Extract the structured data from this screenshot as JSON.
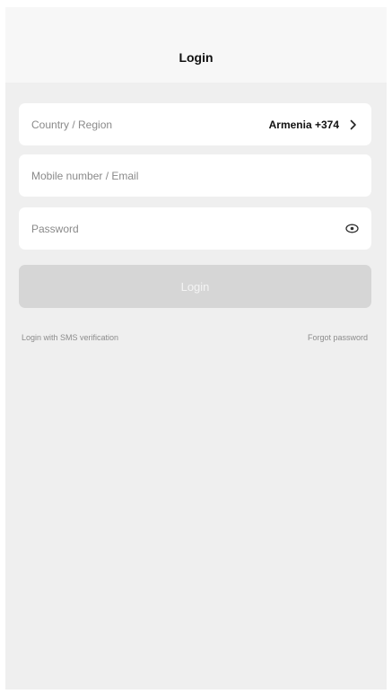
{
  "header": {
    "title": "Login"
  },
  "form": {
    "country": {
      "label": "Country / Region",
      "value": "Armenia +374"
    },
    "mobile": {
      "placeholder": "Mobile number / Email"
    },
    "password": {
      "placeholder": "Password"
    },
    "icons": {
      "country_chevron": "chevron-right-icon",
      "password_toggle": "eye-icon"
    }
  },
  "actions": {
    "login_label": "Login",
    "sms_login_label": "Login with SMS verification",
    "forgot_password_label": "Forgot password"
  },
  "colors": {
    "background": "#efefef",
    "header_background": "#f7f7f7",
    "field_background": "#ffffff",
    "button_disabled": "#d6d6d6",
    "muted_text": "#8a8a8a"
  }
}
